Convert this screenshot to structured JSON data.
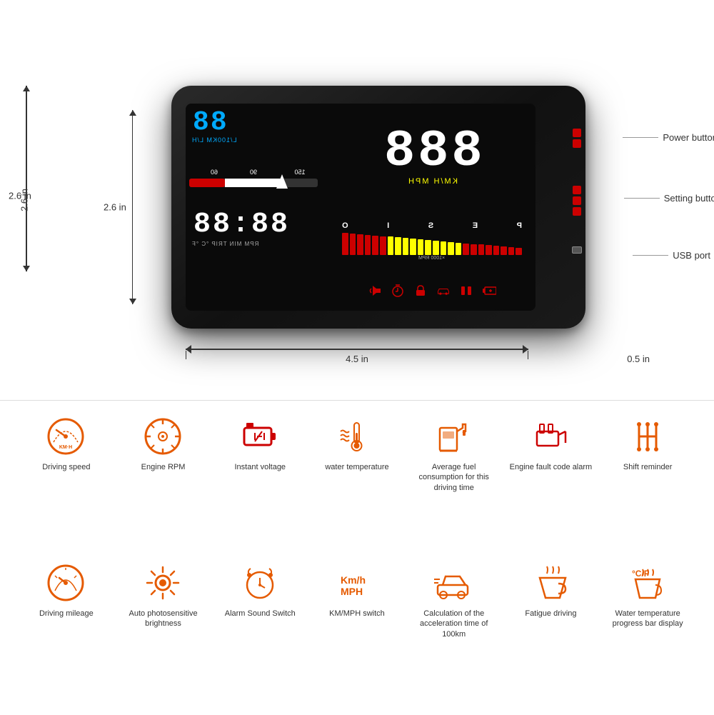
{
  "device": {
    "fuel_digits": "88",
    "fuel_label": "L/100KM  L/H",
    "speed_large": "888",
    "speed_unit": "KM/H  MPH",
    "clock_digits": "88:88",
    "clock_label": "RPM  MIN  TRIP  °C °F",
    "rpm_letters": [
      "P",
      "E",
      "S",
      "I",
      "O"
    ],
    "rpm_label": "×1000 RPM",
    "dimensions": {
      "height": "2.6 in",
      "width": "4.5 in",
      "depth": "0.5 in"
    },
    "buttons": {
      "power": "Power button",
      "setting": "Setting button",
      "usb": "USB port"
    }
  },
  "features": [
    {
      "id": "driving-speed",
      "label": "Driving speed",
      "icon": "speedometer"
    },
    {
      "id": "engine-rpm",
      "label": "Engine RPM",
      "icon": "rpm-gauge"
    },
    {
      "id": "instant-voltage",
      "label": "Instant voltage",
      "icon": "battery-plus"
    },
    {
      "id": "water-temp",
      "label": "water temperature",
      "icon": "thermometer-liquid"
    },
    {
      "id": "avg-fuel",
      "label": "Average fuel consumption for this driving time",
      "icon": "fuel-pump"
    },
    {
      "id": "engine-fault",
      "label": "Engine fault code alarm",
      "icon": "engine-fault"
    },
    {
      "id": "shift-reminder",
      "label": "Shift  reminder",
      "icon": "shift"
    },
    {
      "id": "driving-mileage",
      "label": "Driving mileage",
      "icon": "mileage-gauge"
    },
    {
      "id": "auto-brightness",
      "label": "Auto photosensitive brightness",
      "icon": "auto-bright"
    },
    {
      "id": "alarm-sound",
      "label": "Alarm Sound Switch",
      "icon": "alarm-clock"
    },
    {
      "id": "km-mph",
      "label": "KM/MPH switch",
      "icon": "km-mph",
      "top_text": "Km/h\nMPH"
    },
    {
      "id": "acceleration",
      "label": "Calculation of the acceleration time of 100km",
      "icon": "car-accel"
    },
    {
      "id": "fatigue-driving",
      "label": "Fatigue driving",
      "icon": "fatigue"
    },
    {
      "id": "water-temp-bar",
      "label": "Water temperature progress bar display",
      "icon": "temp-cup",
      "top_text": "°C/F"
    }
  ]
}
